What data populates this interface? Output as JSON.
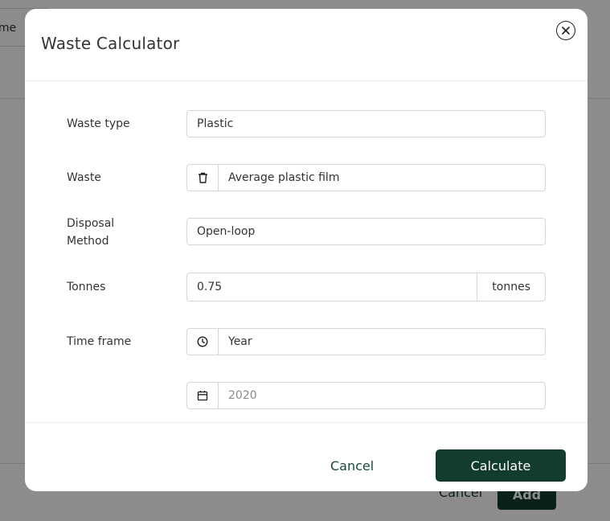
{
  "background": {
    "topbar_text": "ime",
    "cancel_label": "Cancel",
    "add_label": "Add"
  },
  "modal": {
    "title": "Waste Calculator",
    "fields": {
      "waste_type": {
        "label": "Waste type",
        "value": "Plastic"
      },
      "waste": {
        "label": "Waste",
        "value": "Average plastic film",
        "icon": "trash-icon"
      },
      "disposal": {
        "label_line1": "Disposal",
        "label_line2": "Method",
        "value": "Open-loop"
      },
      "tonnes": {
        "label": "Tonnes",
        "value": "0.75",
        "unit": "tonnes"
      },
      "time_frame": {
        "label": "Time frame",
        "value": "Year",
        "icon": "clock-icon"
      },
      "year": {
        "placeholder": "2020",
        "icon": "calendar-icon"
      }
    },
    "footer": {
      "cancel_label": "Cancel",
      "calculate_label": "Calculate"
    }
  },
  "colors": {
    "primary": "#123c2c",
    "link": "#1b4a39",
    "border": "#d5d5d5"
  }
}
